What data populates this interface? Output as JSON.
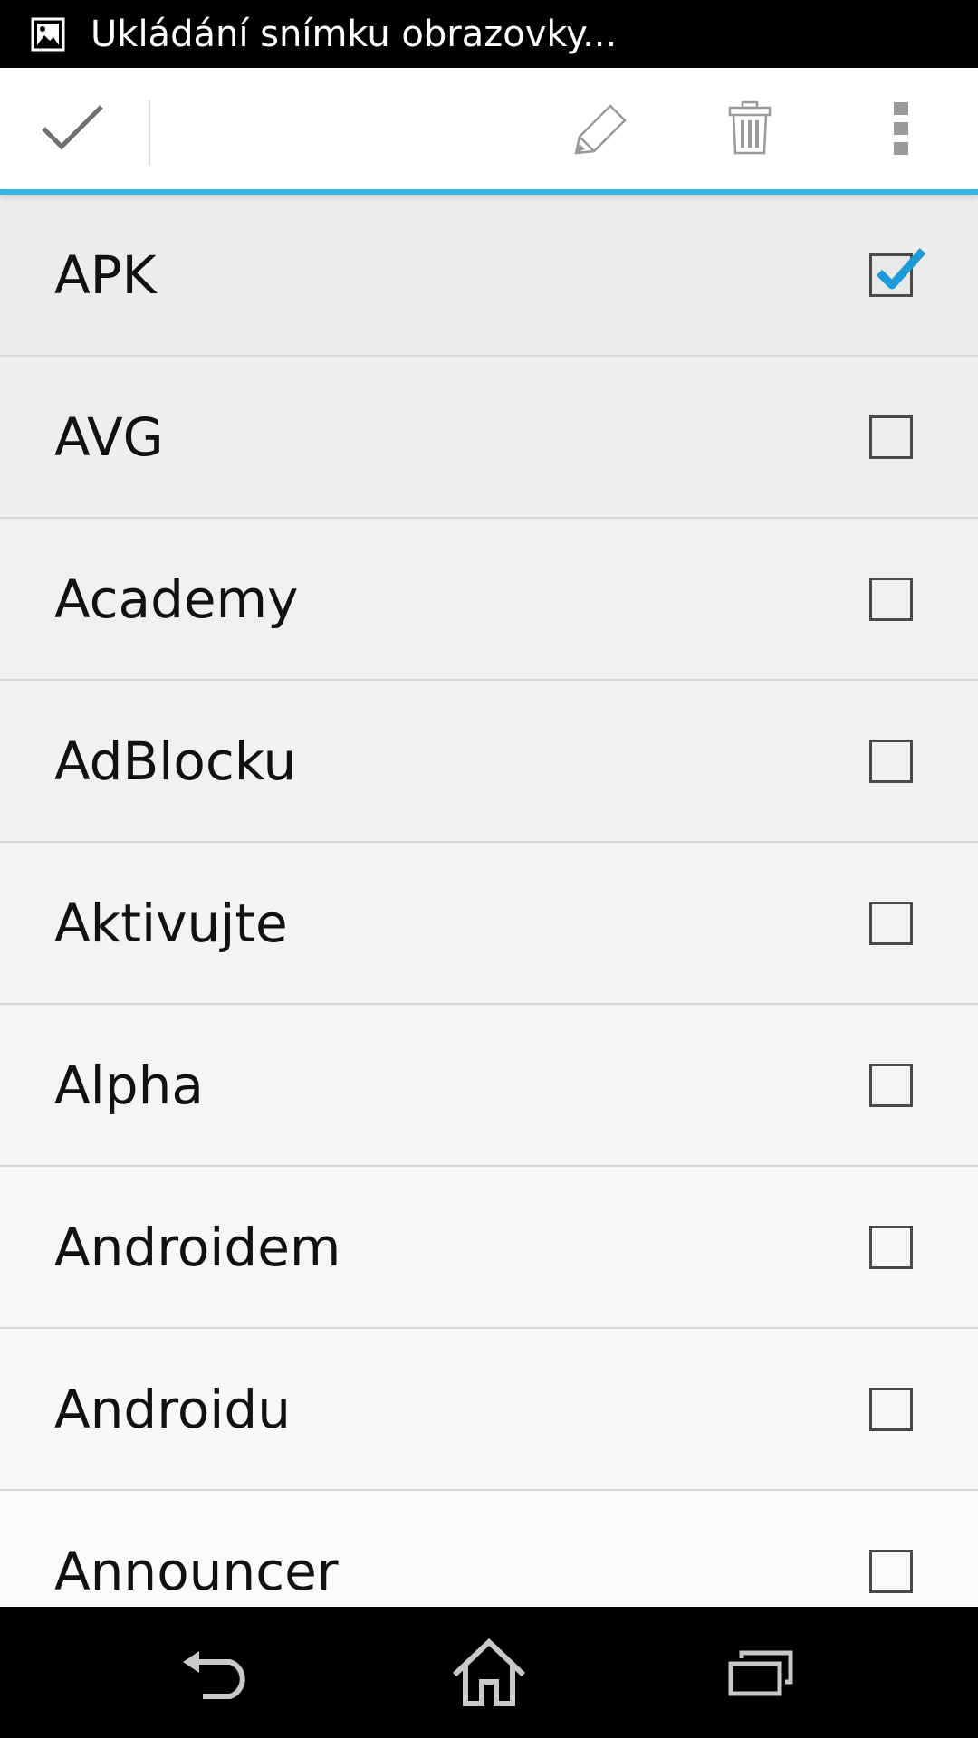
{
  "status_bar": {
    "notification_icon": "image-icon",
    "text": "Ukládání snímku obrazovky..."
  },
  "action_bar": {
    "done_icon": "checkmark-icon",
    "actions": [
      {
        "icon": "pencil-icon"
      },
      {
        "icon": "trash-icon"
      },
      {
        "icon": "overflow-menu-icon"
      }
    ],
    "accent_color": "#33b5e5"
  },
  "list": {
    "items": [
      {
        "label": "APK",
        "checked": true
      },
      {
        "label": "AVG",
        "checked": false
      },
      {
        "label": "Academy",
        "checked": false
      },
      {
        "label": "AdBlocku",
        "checked": false
      },
      {
        "label": "Aktivujte",
        "checked": false
      },
      {
        "label": "Alpha",
        "checked": false
      },
      {
        "label": "Androidem",
        "checked": false
      },
      {
        "label": "Androidu",
        "checked": false
      },
      {
        "label": "Announcer",
        "checked": false
      }
    ],
    "check_color": "#1e9bd7"
  },
  "nav_bar": {
    "buttons": [
      {
        "icon": "back-icon"
      },
      {
        "icon": "home-icon"
      },
      {
        "icon": "recents-icon"
      }
    ]
  }
}
